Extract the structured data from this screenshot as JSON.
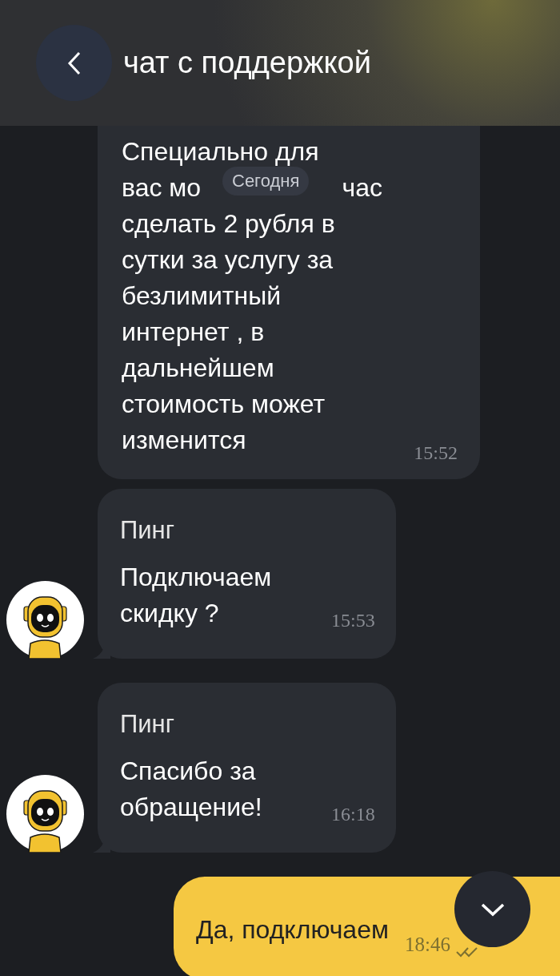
{
  "header": {
    "title": "чат с поддержкой"
  },
  "date_pill": "Сегодня",
  "first_message": {
    "first_line": "Специально для",
    "covered_line_left": "вас мо",
    "covered_line_right": "час",
    "rest": "сделать 2 рубля в сутки за услугу за безлимитный интернет , в дальнейшем стоимость может изменится",
    "time": "15:52"
  },
  "messages": [
    {
      "kind": "incoming",
      "sender": "Пинг",
      "text": "Подключаем скидку ?",
      "time": "15:53",
      "avatar": true
    },
    {
      "kind": "incoming",
      "sender": "Пинг",
      "text": "Спасибо за обращение!",
      "time": "16:18",
      "avatar": true
    },
    {
      "kind": "outgoing",
      "text": "Да, подключаем",
      "time": "18:46",
      "read": true
    }
  ]
}
